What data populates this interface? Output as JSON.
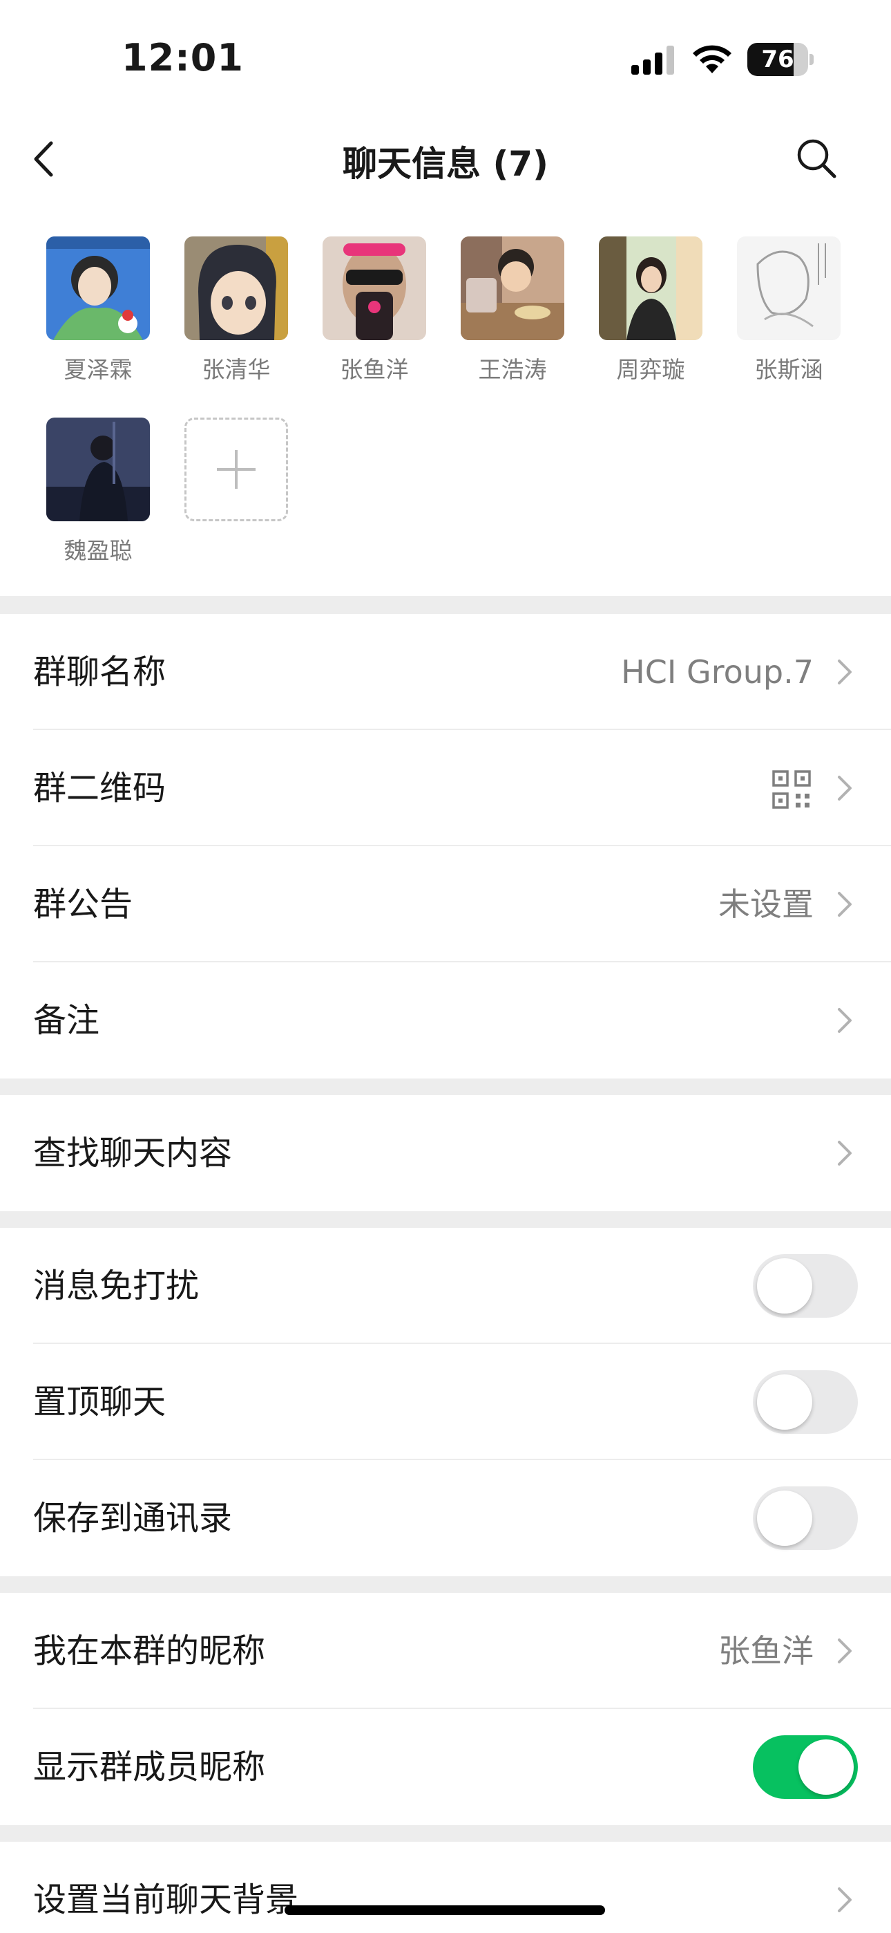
{
  "status_bar": {
    "time": "12:01",
    "battery_level": "76",
    "icons": [
      "cellular-signal-icon",
      "wifi-icon",
      "battery-icon"
    ]
  },
  "nav": {
    "title": "聊天信息 (7)",
    "icons": [
      "back-chevron-icon",
      "search-icon"
    ]
  },
  "members": [
    {
      "name": "夏泽霖",
      "avatar_colors": [
        "#3f7fd6",
        "#6ab86a"
      ]
    },
    {
      "name": "张清华",
      "avatar_colors": [
        "#9a8c74",
        "#e8c8a8"
      ]
    },
    {
      "name": "张鱼洋",
      "avatar_colors": [
        "#e0d2c8",
        "#d43a76"
      ]
    },
    {
      "name": "王浩涛",
      "avatar_colors": [
        "#a88a72",
        "#e8c4a4"
      ]
    },
    {
      "name": "周弈璇",
      "avatar_colors": [
        "#d8e4c8",
        "#6a5c40"
      ]
    },
    {
      "name": "张斯涵",
      "avatar_colors": [
        "#f4f4f4",
        "#bdbdbd"
      ]
    },
    {
      "name": "魏盈聪",
      "avatar_colors": [
        "#3a4466",
        "#1a1f33"
      ]
    }
  ],
  "add_member_icon": "plus-icon",
  "settings": {
    "group_name": {
      "label": "群聊名称",
      "value": "HCI Group.7"
    },
    "group_qr": {
      "label": "群二维码",
      "icon": "qr-code-icon"
    },
    "group_notice": {
      "label": "群公告",
      "value": "未设置"
    },
    "remark": {
      "label": "备注"
    },
    "search_chat": {
      "label": "查找聊天内容"
    },
    "mute": {
      "label": "消息免打扰",
      "on": false
    },
    "pin": {
      "label": "置顶聊天",
      "on": false
    },
    "save_contacts": {
      "label": "保存到通讯录",
      "on": false
    },
    "my_nickname": {
      "label": "我在本群的昵称",
      "value": "张鱼洋"
    },
    "show_nicknames": {
      "label": "显示群成员昵称",
      "on": true
    },
    "background": {
      "label": "设置当前聊天背景"
    }
  },
  "colors": {
    "accent_green": "#07c160",
    "separator": "#ededed",
    "secondary_text": "#7f7f7f"
  }
}
